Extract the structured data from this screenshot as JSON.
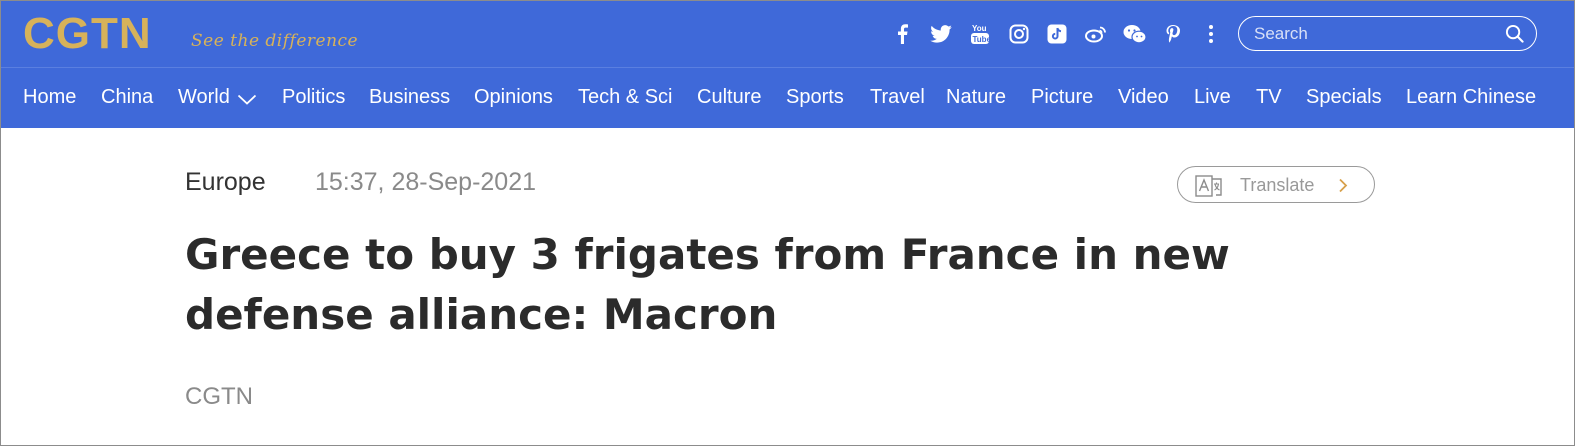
{
  "brand": {
    "logo": "CGTN",
    "slogan": "See the difference",
    "logo_color": "#d7b25a",
    "bar_color": "#3f69d9"
  },
  "social_icons": [
    "facebook-icon",
    "twitter-icon",
    "youtube-icon",
    "instagram-icon",
    "tiktok-icon",
    "weibo-icon",
    "wechat-icon",
    "pinterest-icon",
    "more-icon"
  ],
  "search": {
    "placeholder": "Search"
  },
  "nav": {
    "items": [
      "Home",
      "China",
      "World",
      "Politics",
      "Business",
      "Opinions",
      "Tech & Sci",
      "Culture",
      "Sports",
      "Travel",
      "Nature",
      "Picture",
      "Video",
      "Live",
      "TV",
      "Specials",
      "Learn Chinese"
    ]
  },
  "article": {
    "category": "Europe",
    "timestamp": "15:37, 28-Sep-2021",
    "translate_label": "Translate",
    "headline": "Greece to buy 3 frigates from France in new defense alliance: Macron",
    "source": "CGTN"
  }
}
